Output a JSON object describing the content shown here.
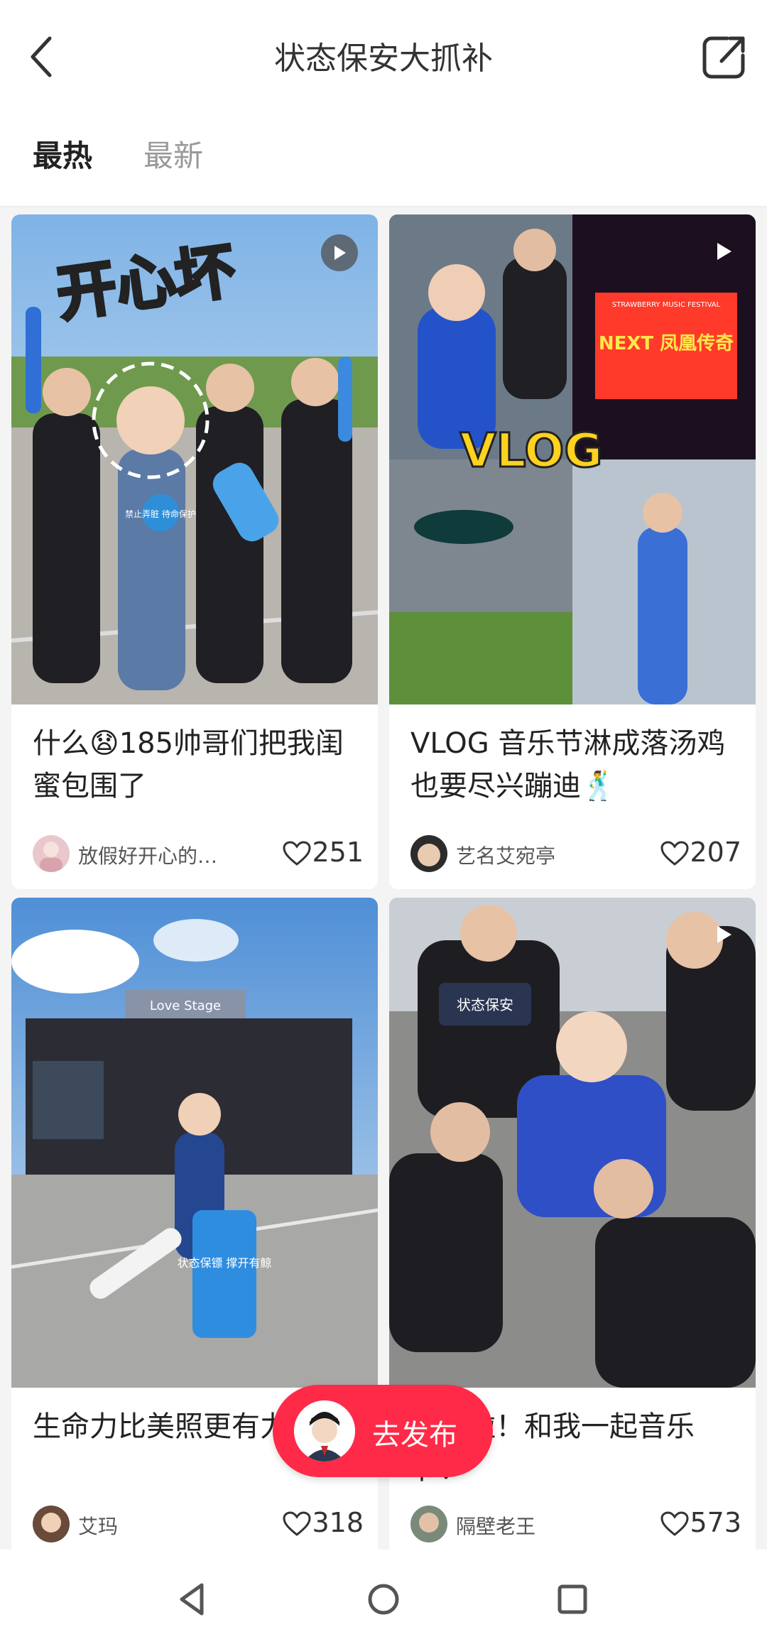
{
  "header": {
    "title": "状态保安大抓补",
    "back_icon": "chevron-left-icon",
    "share_icon": "share-external-icon"
  },
  "tabs": [
    {
      "label": "最热",
      "active": true
    },
    {
      "label": "最新",
      "active": false
    }
  ],
  "cards": [
    {
      "title": "什么😧185帅哥们把我闺蜜包围了",
      "author": "放假好开心的…",
      "likes": "251",
      "image_overlay": "开心坏",
      "badge": "禁止弄脏 待命保护"
    },
    {
      "title": "VLOG 音乐节淋成落汤鸡也要尽兴蹦迪🕺",
      "author": "艺名艾宛亭",
      "likes": "207",
      "image_overlay": "VLOG",
      "screen_text": "NEXT 凤凰传奇",
      "festival_text": "STRAWBERRY MUSIC FESTIVAL"
    },
    {
      "title": "生命力比美照更有力🌼",
      "author": "艾玛",
      "likes": "318",
      "stage_text": "Love Stage",
      "bag_text": "状态保镖 撑开有鲸"
    },
    {
      "title": "抓补啦！和我一起音乐节！",
      "author": "隔壁老王",
      "likes": "573",
      "vest_text": "状态保安"
    }
  ],
  "publish": {
    "label": "去发布"
  },
  "navbar": {
    "icons": [
      "back-triangle-icon",
      "home-circle-icon",
      "recents-square-icon"
    ]
  },
  "colors": {
    "accent": "#ff2a47",
    "muted": "#999999"
  }
}
